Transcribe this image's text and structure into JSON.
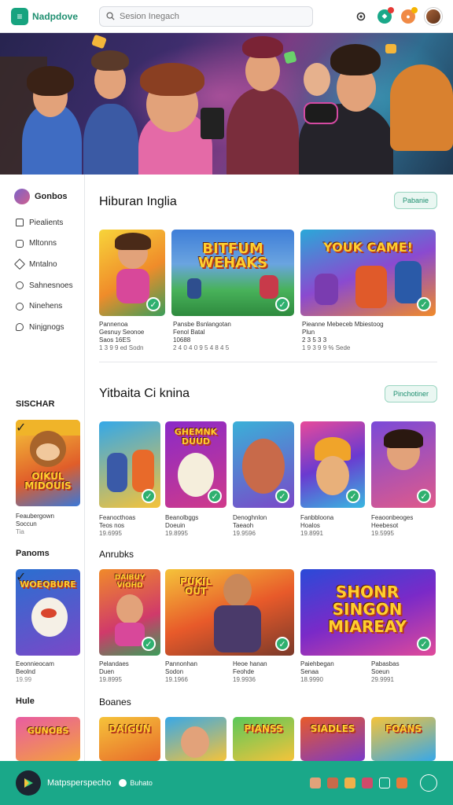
{
  "app": {
    "name": "Nadpdove",
    "logo_glyph": "≡"
  },
  "search": {
    "placeholder": "Sesion Inegach"
  },
  "header_icons": [
    "gear-icon",
    "notification-icon",
    "gift-icon",
    "avatar"
  ],
  "sidebar": {
    "title": "Gonbos",
    "items": [
      {
        "label": "Piealients",
        "icon": "home-icon"
      },
      {
        "label": "Mltonns",
        "icon": "square-icon"
      },
      {
        "label": "Mntalno",
        "icon": "tag-icon"
      },
      {
        "label": "Sahnesnoes",
        "icon": "smile-icon"
      },
      {
        "label": "Ninehens",
        "icon": "question-icon"
      },
      {
        "label": "Ninjgnogs",
        "icon": "chat-icon"
      }
    ],
    "sections": [
      {
        "title": "SISCHAR",
        "caption": [
          "Feaubergown",
          "Soccun",
          "Tia"
        ]
      },
      {
        "title": "Panoms",
        "caption": [
          "Eeonnieocam",
          "Beolnd",
          "19.99"
        ]
      },
      {
        "title": "Hule"
      }
    ]
  },
  "main": {
    "section1": {
      "title": "Hiburan Inglia",
      "button": "Pabanie",
      "cards": [
        {
          "lines": [
            "Pannenoa",
            "Gesnuy Seonoe",
            "Saos 16ES"
          ],
          "meta": "1 3 9 9 ed Sodn"
        },
        {
          "title": "BITFUM WEHAKS",
          "lines": [
            "Pansbe Bsnlangotan",
            "Fenol Batal",
            "10688"
          ],
          "meta": "2 4 0 4 0 9 5 4 8 4 5"
        },
        {
          "title": "YOUK CAME!",
          "lines": [
            "Pieanne Mebeceb Mbiestoog",
            "Plun",
            "2 3 5 3 3"
          ],
          "meta": "1 9 3 9 9 % Sede"
        }
      ]
    },
    "section2": {
      "title": "Yitbaita Ci knina",
      "button": "Pinchotiner",
      "cards": [
        {
          "lines": [
            "Feanocthoas",
            "Teos nos"
          ],
          "meta": "19.6995"
        },
        {
          "title": "GHEMNK DUUD",
          "lines": [
            "Beanolbggs",
            "Doeuin"
          ],
          "meta": "19.8995"
        },
        {
          "lines": [
            "Denoghnlon",
            "Taeaoh"
          ],
          "meta": "19.9596"
        },
        {
          "lines": [
            "Fanbbloona",
            "Hoalos"
          ],
          "meta": "19.8991"
        },
        {
          "lines": [
            "Feaoonbeoges",
            "Heebesot"
          ],
          "meta": "19.5995"
        }
      ]
    },
    "section3": {
      "title": "Anrubks",
      "cards": [
        {
          "title": "DAIBUY VIOHD",
          "lines": [
            "Pelandaes",
            "Duen"
          ],
          "meta": "19.8995"
        },
        {
          "title": "PUKIL OUT",
          "lines": [
            "Pannonhan",
            "Sodon"
          ],
          "meta": "19.1966"
        },
        {
          "lines": [
            "Heoe hanan",
            "Feohde"
          ],
          "meta": "19.9936"
        },
        {
          "title": "SHONR SINGON MIAREAY",
          "lines": [
            "Paiehbegan",
            "Senaa"
          ],
          "meta": "18.9990"
        },
        {
          "lines": [
            "Pabasbas",
            "Soeun"
          ],
          "meta": "29.9991"
        }
      ]
    },
    "section4": {
      "title": "Boanes",
      "cards": [
        {
          "title": "DAIGUN"
        },
        {
          "title": ""
        },
        {
          "title": "PIANSS"
        },
        {
          "title": "SIADLES"
        },
        {
          "title": "FOANS"
        }
      ]
    }
  },
  "bottom_bar": {
    "title": "Matpsperspecho",
    "badge_text": "Buhato"
  },
  "colors": {
    "accent": "#1aa889",
    "brand": "#17a37f"
  }
}
